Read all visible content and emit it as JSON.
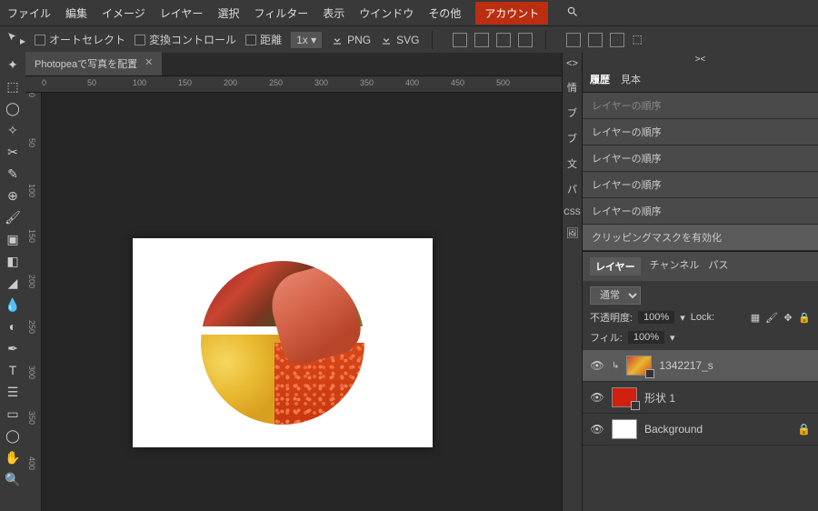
{
  "menu": {
    "items": [
      "ファイル",
      "編集",
      "イメージ",
      "レイヤー",
      "選択",
      "フィルター",
      "表示",
      "ウインドウ",
      "その他"
    ],
    "account": "アカウント"
  },
  "options": {
    "autoselect": "オートセレクト",
    "transform": "変換コントロール",
    "distance": "距離",
    "zoom": "1x",
    "png": "PNG",
    "svg": "SVG"
  },
  "tabs": {
    "doc": "Photopeaで写真を配置"
  },
  "ruler_h": [
    "0",
    "50",
    "100",
    "150",
    "200",
    "250",
    "300",
    "350",
    "400",
    "450",
    "500"
  ],
  "ruler_v": [
    "0",
    "50",
    "100",
    "150",
    "200",
    "250",
    "300",
    "350",
    "400"
  ],
  "sidecol": [
    "<>",
    "情",
    "ブ",
    "ブ",
    "文",
    "パ",
    "CSS",
    "🖼"
  ],
  "sidecol_top": "><",
  "rtabs": [
    "履歴",
    "見本"
  ],
  "history": [
    "レイヤーの順序",
    "レイヤーの順序",
    "レイヤーの順序",
    "レイヤーの順序",
    "レイヤーの順序",
    "クリッピングマスクを有効化"
  ],
  "layertabs": [
    "レイヤー",
    "チャンネル",
    "パス"
  ],
  "layeropts": {
    "blend": "通常",
    "opacity_label": "不透明度:",
    "opacity": "100%",
    "lock_label": "Lock:",
    "fill_label": "フィル:",
    "fill": "100%"
  },
  "layers": [
    {
      "name": "1342217_s",
      "locked": false
    },
    {
      "name": "形状 1",
      "locked": false
    },
    {
      "name": "Background",
      "locked": true
    }
  ]
}
